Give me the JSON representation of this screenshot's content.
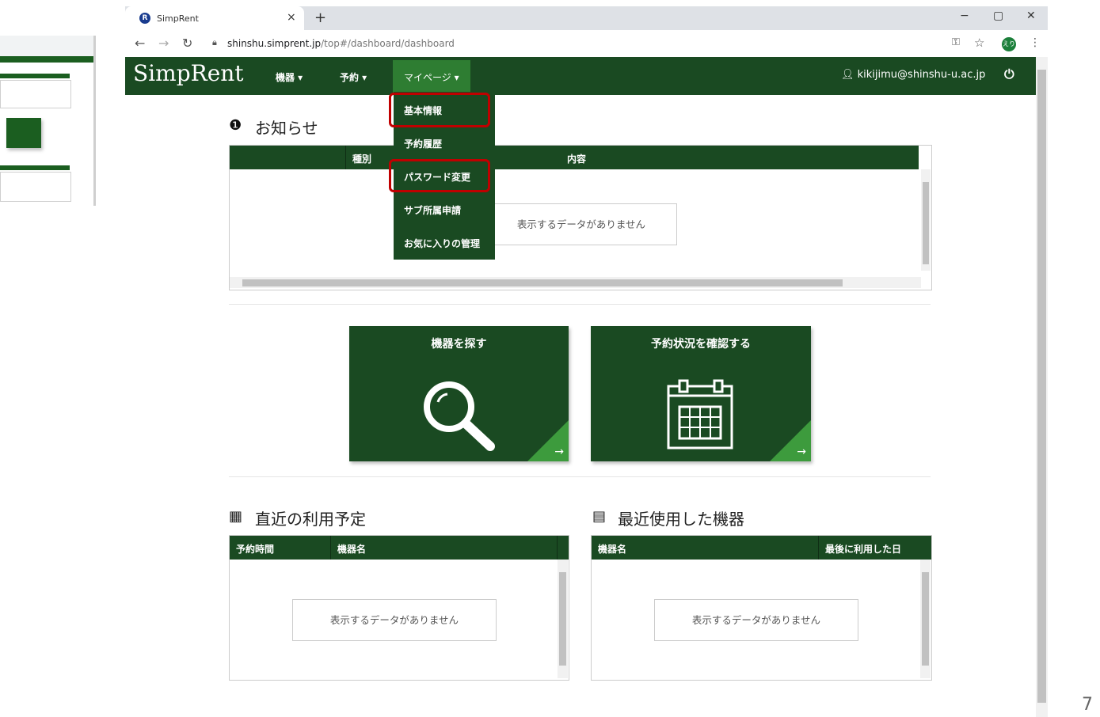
{
  "browser": {
    "tab_title": "SimpRent",
    "tab_close": "×",
    "new_tab": "+",
    "url_host": "shinshu.simprent.jp",
    "url_path": "/top#/dashboard/dashboard",
    "profile_initials": "えり",
    "window_minimize": "−",
    "window_restore": "▢",
    "window_close": "✕"
  },
  "header": {
    "logo": "SimpRent",
    "nav": [
      {
        "label": "機器 ▾"
      },
      {
        "label": "予約 ▾"
      },
      {
        "label": "マイページ ▾"
      }
    ],
    "user_email": "kikijimu@shinshu-u.ac.jp"
  },
  "dropdown": {
    "items": [
      {
        "label": "基本情報"
      },
      {
        "label": "予約履歴"
      },
      {
        "label": "パスワード変更"
      },
      {
        "label": "サブ所属申請"
      },
      {
        "label": "お気に入りの管理"
      }
    ]
  },
  "notices": {
    "title": "お知らせ",
    "columns": [
      "種別",
      "内容"
    ],
    "empty_text": "表示するデータがありません"
  },
  "tiles": [
    {
      "title": "機器を探す",
      "arrow": "→",
      "icon": "search-icon"
    },
    {
      "title": "予約状況を確認する",
      "arrow": "→",
      "icon": "calendar-icon"
    }
  ],
  "upcoming": {
    "title": "直近の利用予定",
    "columns": [
      "予約時間",
      "機器名"
    ],
    "empty_text": "表示するデータがありません"
  },
  "recent": {
    "title": "最近使用した機器",
    "columns": [
      "機器名",
      "最後に利用した日"
    ],
    "empty_text": "表示するデータがありません"
  },
  "page_number": "7",
  "colors": {
    "header": "#1a4a22",
    "accent": "#2e7d32",
    "highlight": "#c00000"
  }
}
